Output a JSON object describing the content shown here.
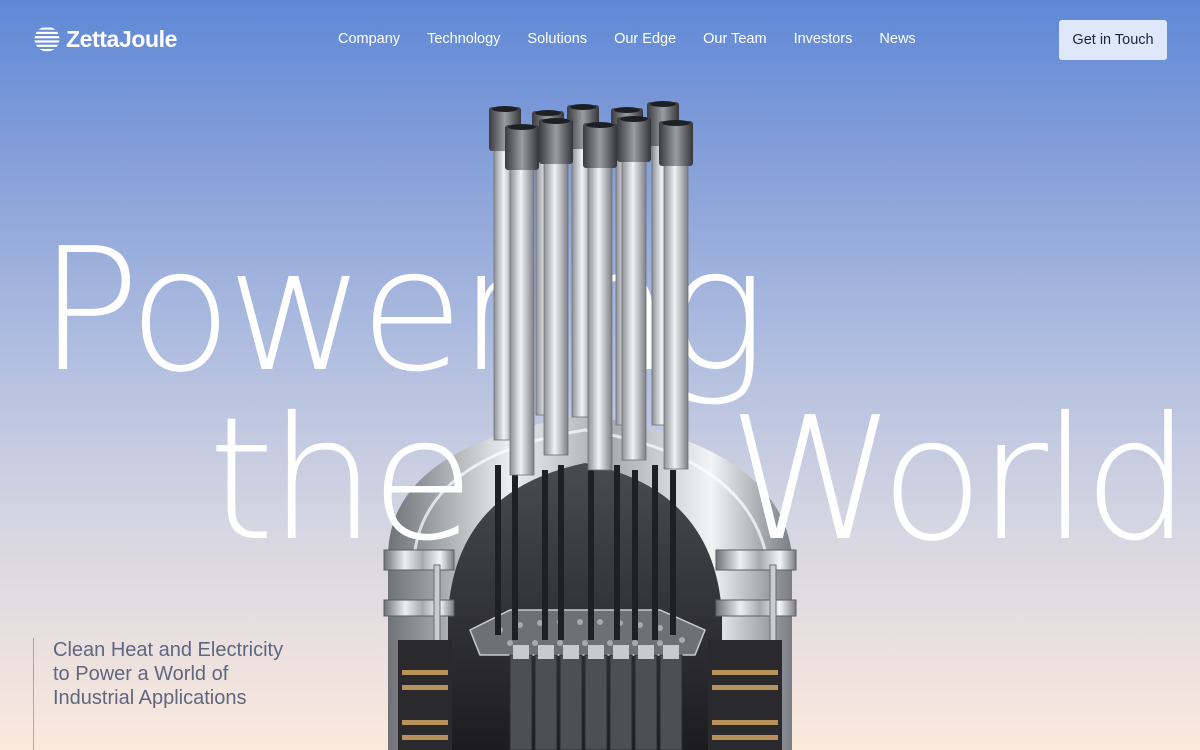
{
  "brand": {
    "name": "ZettaJoule",
    "logo_icon": "globe-stripes-icon"
  },
  "nav": {
    "items": [
      {
        "label": "Company"
      },
      {
        "label": "Technology"
      },
      {
        "label": "Solutions"
      },
      {
        "label": "Our Edge"
      },
      {
        "label": "Our Team"
      },
      {
        "label": "Investors"
      },
      {
        "label": "News"
      }
    ],
    "cta": "Get in Touch"
  },
  "hero": {
    "headline_line1": "Powering",
    "headline_line2_left": "the",
    "headline_line2_right": "World",
    "subtitle_lines": [
      "Clean Heat and Electricity",
      "to Power a World of",
      "Industrial Applications"
    ],
    "image_subject": "reactor-cutaway-illustration"
  },
  "colors": {
    "cta_bg": "#dfe8fb",
    "subtitle": "#5e6780",
    "sky_top": "#5f88d6",
    "sky_bottom": "#fbe9dc"
  }
}
